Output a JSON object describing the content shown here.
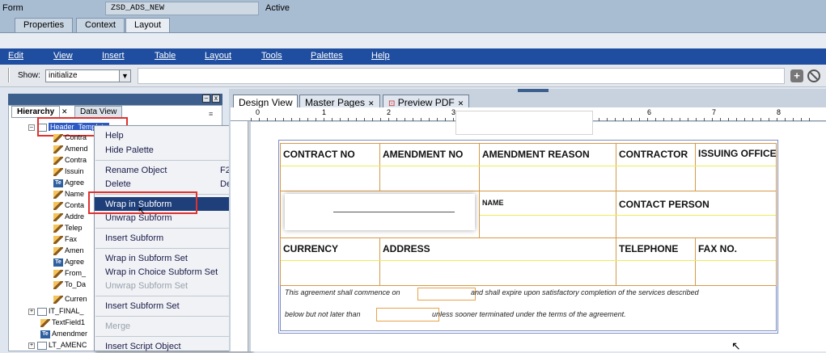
{
  "form_bar": {
    "label": "Form",
    "value": "ZSD_ADS_NEW",
    "status": "Active"
  },
  "top_tabs": [
    "Properties",
    "Context",
    "Layout"
  ],
  "menu": [
    "Edit",
    "View",
    "Insert",
    "Table",
    "Layout",
    "Tools",
    "Palettes",
    "Help"
  ],
  "toolbar": {
    "show_label": "Show:",
    "show_value": "initialize"
  },
  "left_tabs": [
    "Hierarchy",
    "Data View"
  ],
  "tree": [
    {
      "label": "Header_Template",
      "icon": "page-icon"
    },
    {
      "label": "Contra",
      "icon": "pen-icon"
    },
    {
      "label": "Amend",
      "icon": "pen-icon"
    },
    {
      "label": "Contra",
      "icon": "pen-icon"
    },
    {
      "label": "Issuin",
      "icon": "pen-icon"
    },
    {
      "label": "Agree",
      "icon": "text-icon"
    },
    {
      "label": "Name",
      "icon": "pen-icon"
    },
    {
      "label": "Conta",
      "icon": "pen-icon"
    },
    {
      "label": "Addre",
      "icon": "pen-icon"
    },
    {
      "label": "Telep",
      "icon": "pen-icon"
    },
    {
      "label": "Fax",
      "icon": "pen-icon"
    },
    {
      "label": "Amen",
      "icon": "pen-icon"
    },
    {
      "label": "Agree",
      "icon": "text-icon"
    },
    {
      "label": "From_",
      "icon": "pen-icon"
    },
    {
      "label": "To_Da",
      "icon": "pen-icon"
    },
    {
      "label": "Curren",
      "icon": "pen-icon"
    },
    {
      "label": "IT_FINAL_",
      "icon": "page-icon"
    },
    {
      "label": "TextField1",
      "icon": "pen-icon"
    },
    {
      "label": "Amendmer",
      "icon": "text-icon"
    },
    {
      "label": "LT_AMENC",
      "icon": "page-icon"
    }
  ],
  "context_menu": [
    {
      "label": "Help",
      "shortcut": "",
      "disabled": false
    },
    {
      "label": "Hide Palette",
      "shortcut": "",
      "disabled": false
    },
    {
      "label": "Rename Object",
      "shortcut": "F2",
      "disabled": false
    },
    {
      "label": "Delete",
      "shortcut": "Del",
      "disabled": false
    },
    {
      "label": "Wrap in Subform",
      "shortcut": "",
      "disabled": false,
      "highlighted": true
    },
    {
      "label": "Unwrap Subform",
      "shortcut": "",
      "disabled": false
    },
    {
      "label": "Insert Subform",
      "shortcut": "",
      "disabled": false
    },
    {
      "label": "Wrap in Subform Set",
      "shortcut": "",
      "disabled": false
    },
    {
      "label": "Wrap in Choice Subform Set",
      "shortcut": "",
      "disabled": false
    },
    {
      "label": "Unwrap Subform Set",
      "shortcut": "",
      "disabled": true
    },
    {
      "label": "Insert Subform Set",
      "shortcut": "",
      "disabled": false
    },
    {
      "label": "Merge",
      "shortcut": "",
      "disabled": true
    },
    {
      "label": "Insert Script Object",
      "shortcut": "",
      "disabled": false
    }
  ],
  "design_tabs": [
    "Design View",
    "Master Pages",
    "Preview PDF"
  ],
  "ruler_numbers": [
    "0",
    "1",
    "2",
    "3",
    "6",
    "7",
    "8"
  ],
  "form_fields": {
    "contract_no": "CONTRACT NO",
    "amendment_no": "AMENDMENT NO",
    "amendment_reason": "AMENDMENT REASON",
    "contractor": "CONTRACTOR",
    "issuing_office": "ISSUING OFFICE",
    "name": "NAME",
    "contact_person": "CONTACT PERSON",
    "currency": "CURRENCY",
    "address": "ADDRESS",
    "telephone": "TELEPHONE",
    "fax_no": "FAX NO."
  },
  "agreement_text": {
    "line1_a": "This agreement shall commence on",
    "line1_b": "and shall expire upon satisfactory completion of the services described",
    "line2_a": "below but  not later than",
    "line2_b": "unless sooner terminated under the terms of the agreement."
  },
  "colors": {
    "menubar": "#1f4ea0",
    "highlight_box": "#e0312e",
    "cell_border": "#d59a4a"
  }
}
